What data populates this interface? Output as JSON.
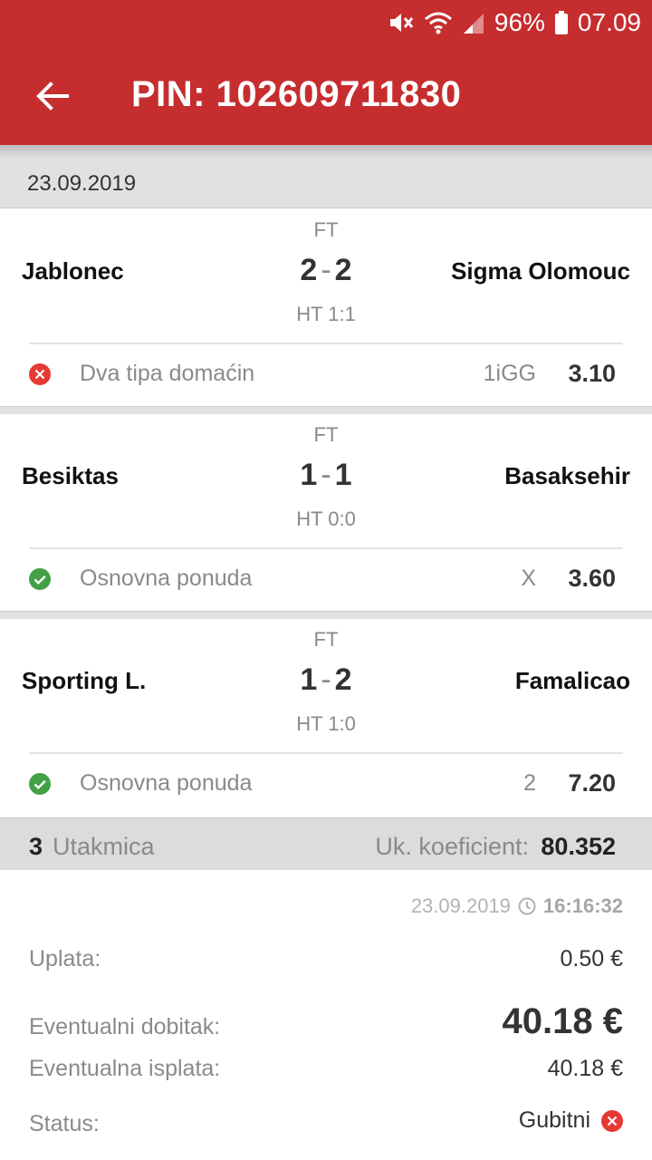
{
  "status_bar": {
    "battery": "96%",
    "time": "07.09"
  },
  "header": {
    "title": "PIN: 102609711830"
  },
  "date_group": "23.09.2019",
  "matches": [
    {
      "status": "FT",
      "home": "Jablonec",
      "away": "Sigma Olomouc",
      "score_home": "2",
      "score_away": "2",
      "score_sep": "-",
      "halftime": "HT 1:1",
      "result": "lost",
      "market": "Dva tipa domaćin",
      "pick": "1iGG",
      "odds": "3.10"
    },
    {
      "status": "FT",
      "home": "Besiktas",
      "away": "Basaksehir",
      "score_home": "1",
      "score_away": "1",
      "score_sep": "-",
      "halftime": "HT 0:0",
      "result": "won",
      "market": "Osnovna ponuda",
      "pick": "X",
      "odds": "3.60"
    },
    {
      "status": "FT",
      "home": "Sporting L.",
      "away": "Famalicao",
      "score_home": "1",
      "score_away": "2",
      "score_sep": "-",
      "halftime": "HT 1:0",
      "result": "won",
      "market": "Osnovna ponuda",
      "pick": "2",
      "odds": "7.20"
    }
  ],
  "summary": {
    "count": "3",
    "count_label": "Utakmica",
    "total_label": "Uk. koeficient:",
    "total_value": "80.352"
  },
  "details": {
    "date": "23.09.2019",
    "time": "16:16:32",
    "stake_label": "Uplata:",
    "stake_value": "0.50 €",
    "possible_win_label": "Eventualni dobitak:",
    "possible_win_value": "40.18 €",
    "possible_payout_label": "Eventualna isplata:",
    "possible_payout_value": "40.18 €",
    "status_label": "Status:",
    "status_value": "Gubitni"
  },
  "colors": {
    "brand_red": "#c62d2f",
    "won_green": "#43a047",
    "lost_red": "#e53935"
  }
}
